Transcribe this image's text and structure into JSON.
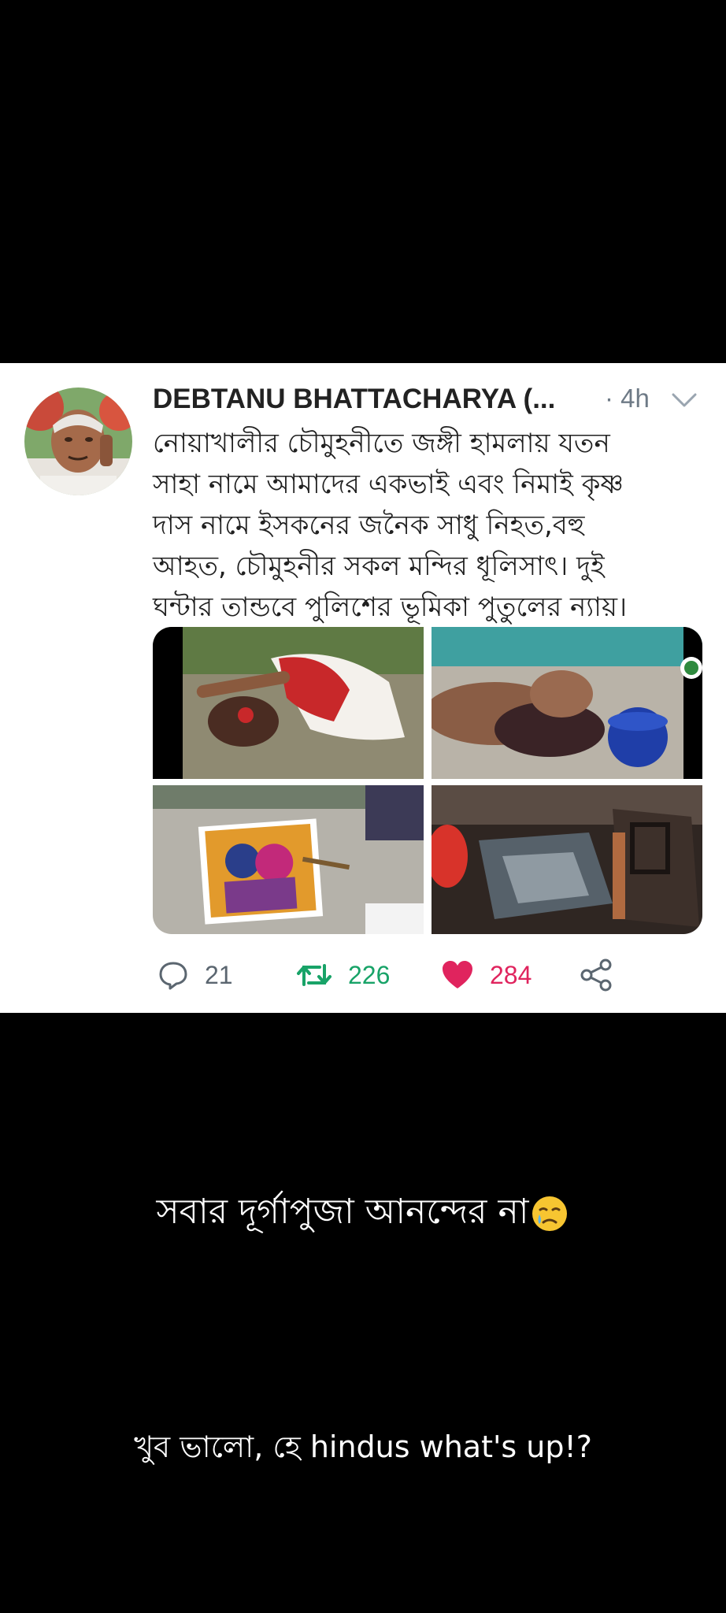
{
  "tweet": {
    "author_name": "DEBTANU BHATTACHARYA (...",
    "timestamp": "· 4h",
    "text_lines": [
      "নোয়াখালীর চৌমুহনীতে জঙ্গী হামলায় যতন",
      "সাহা নামে আমাদের একভাই এবং নিমাই কৃষ্ণ",
      "দাস নামে ইসকনের জনৈক সাধু নিহত,বহু",
      "আহত, চৌমুহনীর সকল মন্দির ধূলিসাৎ। দুই",
      "ঘন্টার তান্ডবে পুলিশের ভূমিকা পুতুলের ন্যায়।"
    ],
    "replies": "21",
    "retweets": "226",
    "likes": "284",
    "icons": {
      "reply": "reply-bubble-icon",
      "retweet": "retweet-arrows-icon",
      "like": "heart-filled-icon",
      "share": "share-nodes-icon",
      "more": "chevron-down-icon"
    },
    "colors": {
      "retweet": "#18a368",
      "like": "#e0245e",
      "muted": "#6e7a86"
    }
  },
  "captions": {
    "line1": "সবার দূর্গাপুজা আনন্দের না",
    "line1_emoji": "crying-face-emoji",
    "line2": "খুব ভালো, হে hindus what's up!?"
  }
}
